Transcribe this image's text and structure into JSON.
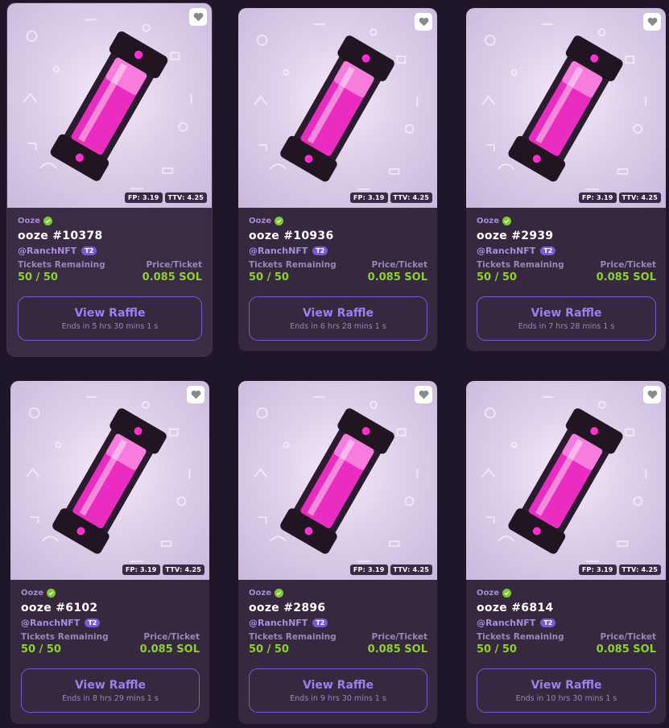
{
  "cards": [
    {
      "collection": "Ooze",
      "name": "ooze #10378",
      "creator": "@RanchNFT",
      "tier": "T2",
      "fp": "FP: 3.19",
      "ttv": "TTV: 4.25",
      "tickets_label": "Tickets Remaining",
      "tickets": "50 / 50",
      "price_label": "Price/Ticket",
      "price": "0.085 SOL",
      "button": "View Raffle",
      "ends": "Ends in 5 hrs 30 mins 1 s"
    },
    {
      "collection": "Ooze",
      "name": "ooze #10936",
      "creator": "@RanchNFT",
      "tier": "T2",
      "fp": "FP: 3.19",
      "ttv": "TTV: 4.25",
      "tickets_label": "Tickets Remaining",
      "tickets": "50 / 50",
      "price_label": "Price/Ticket",
      "price": "0.085 SOL",
      "button": "View Raffle",
      "ends": "Ends in 6 hrs 28 mins 1 s"
    },
    {
      "collection": "Ooze",
      "name": "ooze #2939",
      "creator": "@RanchNFT",
      "tier": "T2",
      "fp": "FP: 3.19",
      "ttv": "TTV: 4.25",
      "tickets_label": "Tickets Remaining",
      "tickets": "50 / 50",
      "price_label": "Price/Ticket",
      "price": "0.085 SOL",
      "button": "View Raffle",
      "ends": "Ends in 7 hrs 28 mins 1 s"
    },
    {
      "collection": "Ooze",
      "name": "ooze #6102",
      "creator": "@RanchNFT",
      "tier": "T2",
      "fp": "FP: 3.19",
      "ttv": "TTV: 4.25",
      "tickets_label": "Tickets Remaining",
      "tickets": "50 / 50",
      "price_label": "Price/Ticket",
      "price": "0.085 SOL",
      "button": "View Raffle",
      "ends": "Ends in 8 hrs 29 mins 1 s"
    },
    {
      "collection": "Ooze",
      "name": "ooze #2896",
      "creator": "@RanchNFT",
      "tier": "T2",
      "fp": "FP: 3.19",
      "ttv": "TTV: 4.25",
      "tickets_label": "Tickets Remaining",
      "tickets": "50 / 50",
      "price_label": "Price/Ticket",
      "price": "0.085 SOL",
      "button": "View Raffle",
      "ends": "Ends in 9 hrs 30 mins 1 s"
    },
    {
      "collection": "Ooze",
      "name": "ooze #6814",
      "creator": "@RanchNFT",
      "tier": "T2",
      "fp": "FP: 3.19",
      "ttv": "TTV: 4.25",
      "tickets_label": "Tickets Remaining",
      "tickets": "50 / 50",
      "price_label": "Price/Ticket",
      "price": "0.085 SOL",
      "button": "View Raffle",
      "ends": "Ends in 10 hrs 30 mins 1 s"
    }
  ],
  "icons": {
    "favorite": "heart-icon",
    "verified": "check-circle-icon"
  },
  "colors": {
    "background": "#1f1729",
    "card": "#35283f",
    "accent": "#7a5ad1",
    "price_green": "#8fd12e",
    "ooze_pink": "#ff2fd0"
  }
}
